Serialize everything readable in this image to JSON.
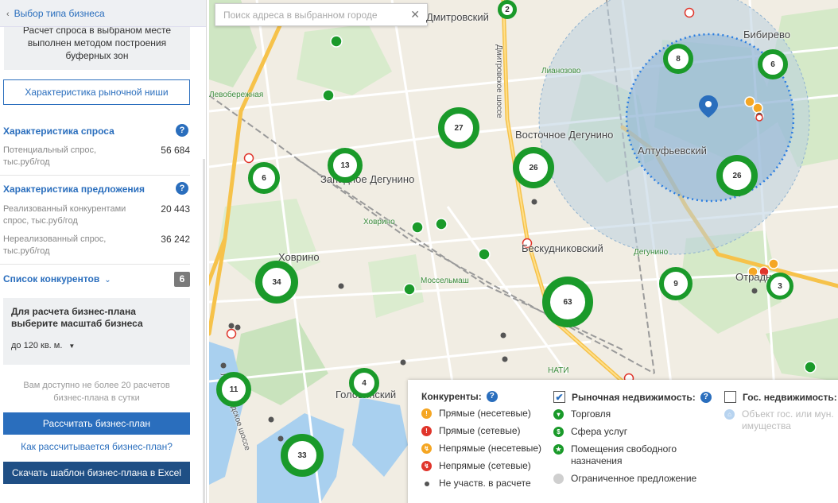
{
  "sidebar": {
    "back_label": "Выбор типа бизнеса",
    "info_lines": [
      "Расчет спроса в выбраном месте",
      "выполнен методом построения",
      "буферных зон"
    ],
    "niche_button": "Характеристика рыночной ниши",
    "demand": {
      "title": "Характеристика спроса",
      "rows": [
        {
          "label": "Потенциальный спрос, тыс.руб/год",
          "value": "56 684"
        }
      ]
    },
    "supply": {
      "title": "Характеристика предложения",
      "rows": [
        {
          "label": "Реализованный конкурентами спрос, тыс.руб/год",
          "value": "20 443"
        },
        {
          "label": "Нереализованный спрос, тыс.руб/год",
          "value": "36 242"
        }
      ]
    },
    "competitors": {
      "title": "Список конкурентов",
      "count": "6"
    },
    "business_plan": {
      "title_line1": "Для расчета бизнес-плана",
      "title_line2": "выберите масштаб бизнеса",
      "scale_value": "до 120 кв. м."
    },
    "limit_note_line1": "Вам доступно не более 20 расчетов",
    "limit_note_line2": "бизнес-плана в сутки",
    "calc_button": "Рассчитать бизнес-план",
    "how_link": "Как рассчитывается бизнес-план?",
    "download_button": "Скачать шаблон бизнес-плана в Excel"
  },
  "map": {
    "search_placeholder": "Поиск адреса в выбранном городе",
    "places": [
      {
        "id": "dmitrovsky",
        "text": "Дмитровский"
      },
      {
        "id": "bibirevo",
        "text": "Бибирево"
      },
      {
        "id": "vost-degunino",
        "text": "Восточное Дегунино"
      },
      {
        "id": "altufyevsky",
        "text": "Алтуфьевский"
      },
      {
        "id": "zap-degunino",
        "text": "Западное Дегунино"
      },
      {
        "id": "khovrino",
        "text": "Ховрино"
      },
      {
        "id": "beskudnikovsky",
        "text": "Бескудниковский"
      },
      {
        "id": "otradnoe",
        "text": "Отрадное"
      },
      {
        "id": "golovinsky",
        "text": "Головинский"
      },
      {
        "id": "levoberezhnaya",
        "text": "Левобережная"
      },
      {
        "id": "likhovo-st",
        "text": "Ховрино"
      },
      {
        "id": "mosselmash",
        "text": "Моссельмаш"
      },
      {
        "id": "lianozovo",
        "text": "Лианозово"
      },
      {
        "id": "degunino-st",
        "text": "Дегунино"
      },
      {
        "id": "nati",
        "text": "НАТИ"
      },
      {
        "id": "dmitrovskoe-sh",
        "text": "Дмитровское шоссе"
      },
      {
        "id": "leningradskoe-sh",
        "text": "Ленинградское шоссе"
      }
    ],
    "clusters": [
      {
        "id": "c2",
        "label": "2"
      },
      {
        "id": "c8",
        "label": "8"
      },
      {
        "id": "c6a",
        "label": "6"
      },
      {
        "id": "c27",
        "label": "27"
      },
      {
        "id": "c26a",
        "label": "26"
      },
      {
        "id": "c26b",
        "label": "26"
      },
      {
        "id": "c13",
        "label": "13"
      },
      {
        "id": "c6b",
        "label": "6"
      },
      {
        "id": "c34",
        "label": "34"
      },
      {
        "id": "c63",
        "label": "63"
      },
      {
        "id": "c9",
        "label": "9"
      },
      {
        "id": "c3",
        "label": "3"
      },
      {
        "id": "c4",
        "label": "4"
      },
      {
        "id": "c11",
        "label": "11"
      },
      {
        "id": "c33",
        "label": "33"
      }
    ]
  },
  "legend": {
    "competitors_title": "Конкуренты:",
    "competitors_items": [
      "Прямые (несетевые)",
      "Прямые (сетевые)",
      "Непрямые (несетевые)",
      "Непрямые (сетевые)",
      "Не участв. в расчете"
    ],
    "market_title": "Рыночная недвижимость:",
    "market_items": [
      "Торговля",
      "Сфера услуг",
      "Помещения свободного назначения",
      "Ограниченное предложение"
    ],
    "gov_title": "Гос. недвижимость:",
    "gov_items": [
      "Объект гос. или мун. имущества"
    ],
    "colors": {
      "direct_nonchain": "#f5a623",
      "direct_chain": "#e0352b",
      "indirect_nonchain": "#f5a623",
      "indirect_chain": "#e0352b",
      "not_counted": "#555555",
      "green": "#1a9a2a",
      "gov": "#b8d4f0"
    }
  }
}
